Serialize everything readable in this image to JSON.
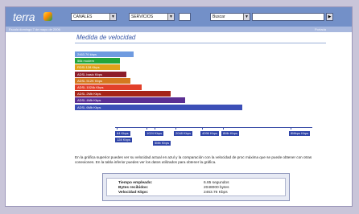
{
  "header": {
    "logo": "terra",
    "selects": [
      "CANALES",
      "SERVICIOS",
      "Buscar"
    ],
    "arrow": "▼",
    "go": "▶"
  },
  "date_bar": {
    "date": "Escala domingo 7 de mayo de 2006",
    "right": "Portada"
  },
  "section_title": "Medida de velocidad",
  "bars": [
    {
      "label": "2463.76 kbps",
      "color": "#6f9be0",
      "fraction": 0.35
    },
    {
      "label": "56k modem",
      "color": "#23a53a",
      "fraction": 0.27
    },
    {
      "label": "RDSI 128 Kbps",
      "color": "#e0a21b",
      "fraction": 0.27
    },
    {
      "label": "ADSL basic Kbps",
      "color": "#8d1d2a",
      "fraction": 0.31
    },
    {
      "label": "ADSL 512K Kbps",
      "color": "#d4781f",
      "fraction": 0.33
    },
    {
      "label": "ADSL 1024k Kbps",
      "color": "#e2402a",
      "fraction": 0.4
    },
    {
      "label": "ADSL 2Mb Kbps",
      "color": "#a52418",
      "fraction": 0.57
    },
    {
      "label": "ADSL 4Mb Kbps",
      "color": "#5b2f93",
      "fraction": 0.66
    },
    {
      "label": "ADSL 6Mb Kbps",
      "color": "#3c4fb7",
      "fraction": 1.0
    }
  ],
  "scale_labels": [
    "64 Kbps",
    "128 Kbps",
    "1024 Kbps",
    "2048 Kbps",
    "4096 Kbps",
    "8Mb Kbps",
    "5Mb Kbps",
    "8Mbps Kbps"
  ],
  "info_text": "En la gráfica superior puedes ver su velocidad actual en azul y la comparación con la velocidad de proc máxima que se puede obtener con otras conexiones. En la tabla inferior puedes ver los datos utilizados para obtener la gráfica.",
  "results": [
    {
      "label": "Tiempo empleado:",
      "value": "6.65 segundos"
    },
    {
      "label": "Bytes recibidos:",
      "value": "2048000 bytes"
    },
    {
      "label": "Velocidad Kbps:",
      "value": "2463.76 Kbps"
    }
  ]
}
